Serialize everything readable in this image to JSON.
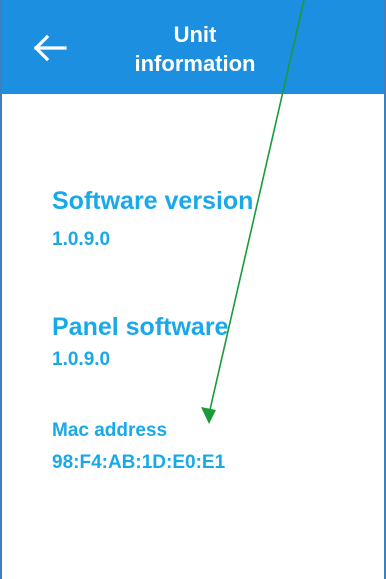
{
  "header": {
    "title_line1": "Unit",
    "title_line2": "information",
    "back_icon": "arrow-left-icon"
  },
  "sections": {
    "software_version": {
      "label": "Software version",
      "value": "1.0.9.0"
    },
    "panel_software": {
      "label": "Panel software",
      "value": "1.0.9.0"
    },
    "mac_address": {
      "label": "Mac address",
      "value": "98:F4:AB:1D:E0:E1"
    }
  },
  "colors": {
    "header_bg": "#1c8fe0",
    "text_accent": "#19a9ea",
    "annotation_arrow": "#1a9b3a"
  }
}
